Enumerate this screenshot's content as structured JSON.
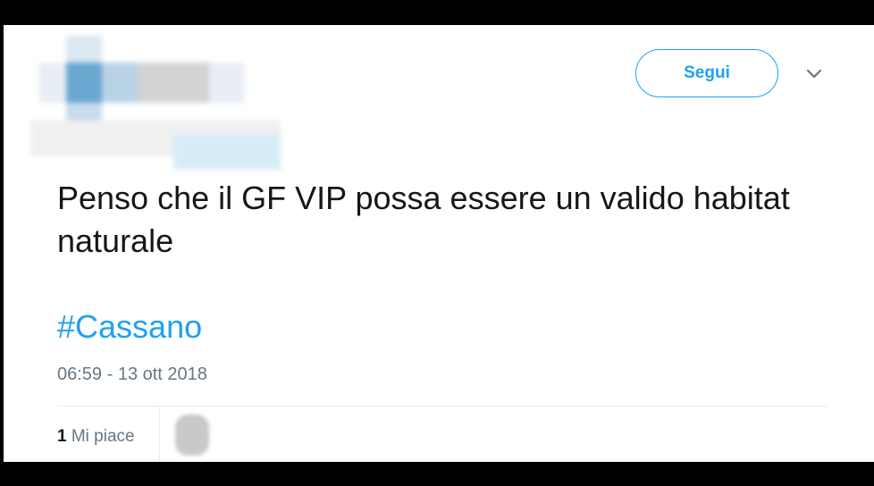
{
  "header": {
    "follow_label": "Segui",
    "menu_icon": "chevron-down-icon"
  },
  "tweet": {
    "text": "Penso che il GF VIP possa essere un valido habitat naturale",
    "hashtag": "#Cassano",
    "timestamp": "06:59 - 13 ott 2018"
  },
  "stats": {
    "likes_count": "1",
    "likes_label": "Mi piace"
  },
  "colors": {
    "accent": "#1DA1F2",
    "text": "#14171a",
    "muted": "#657786"
  }
}
